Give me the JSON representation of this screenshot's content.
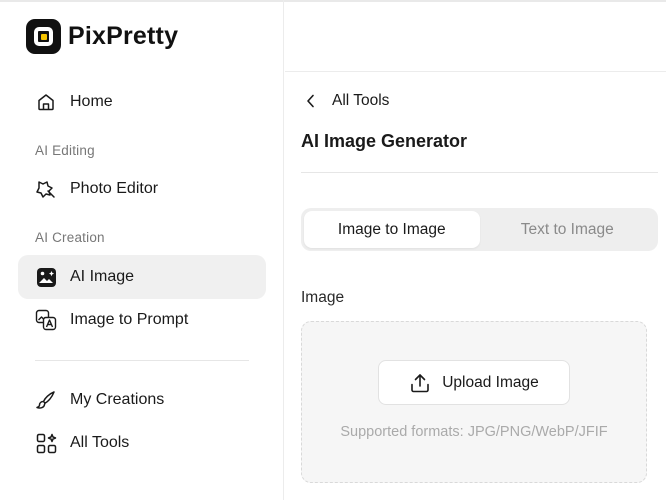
{
  "brand": {
    "name": "PixPretty"
  },
  "sidebar": {
    "items": [
      {
        "label": "Home",
        "icon": "home-icon"
      },
      {
        "section": "AI Editing"
      },
      {
        "label": "Photo Editor",
        "icon": "photo-editor-icon"
      },
      {
        "section": "AI Creation"
      },
      {
        "label": "AI Image",
        "icon": "ai-image-icon",
        "active": true
      },
      {
        "label": "Image to Prompt",
        "icon": "image-to-prompt-icon"
      },
      {
        "label": "My Creations",
        "icon": "brush-icon"
      },
      {
        "label": "All Tools",
        "icon": "grid-icon"
      }
    ]
  },
  "main": {
    "back_label": "All Tools",
    "title": "AI Image Generator",
    "tabs": [
      {
        "label": "Image to Image",
        "active": true
      },
      {
        "label": "Text to Image",
        "active": false
      }
    ],
    "image_field": {
      "label": "Image",
      "upload_label": "Upload Image",
      "formats_note": "Supported formats: JPG/PNG/WebP/JFIF"
    }
  },
  "colors": {
    "brand_dot": "#f5c400",
    "active_bg": "#f0f0f0",
    "muted_text": "#aaaaaa"
  }
}
